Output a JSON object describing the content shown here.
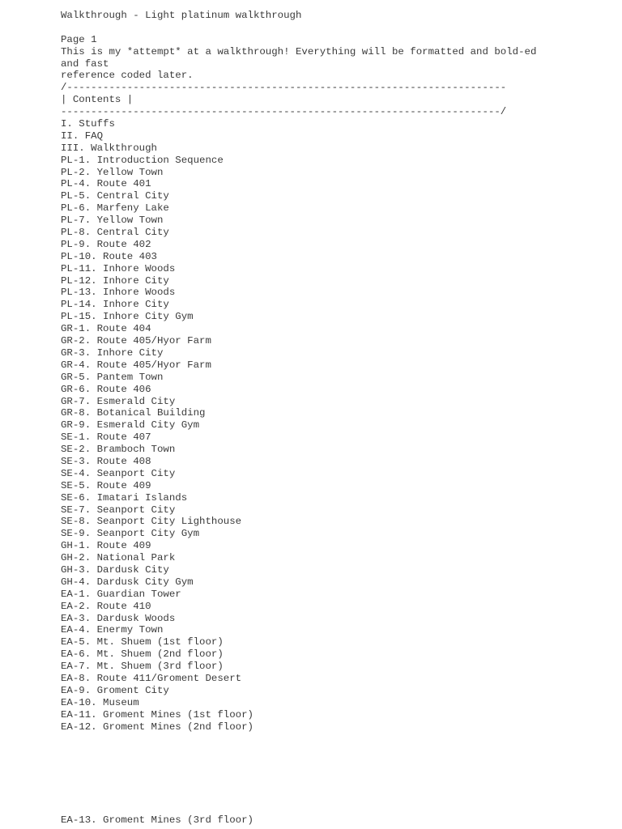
{
  "document": {
    "title": "Walkthrough - Light platinum walkthrough",
    "page_label": "Page 1",
    "intro_lines": [
      "This is my *attempt* at a walkthrough! Everything will be formatted and bold-ed",
      "and fast",
      "reference coded later."
    ],
    "box_top": "/-------------------------------------------------------------------------",
    "box_label": "| Contents |",
    "box_bottom": "-------------------------------------------------------------------------/",
    "contents": [
      "I. Stuffs",
      "II. FAQ",
      "III. Walkthrough",
      "PL-1. Introduction Sequence",
      "PL-2. Yellow Town",
      "PL-4. Route 401",
      "PL-5. Central City",
      "PL-6. Marfeny Lake",
      "PL-7. Yellow Town",
      "PL-8. Central City",
      "PL-9. Route 402",
      "PL-10. Route 403",
      "PL-11. Inhore Woods",
      "PL-12. Inhore City",
      "PL-13. Inhore Woods",
      "PL-14. Inhore City",
      "PL-15. Inhore City Gym",
      "GR-1. Route 404",
      "GR-2. Route 405/Hyor Farm",
      "GR-3. Inhore City",
      "GR-4. Route 405/Hyor Farm",
      "GR-5. Pantem Town",
      "GR-6. Route 406",
      "GR-7. Esmerald City",
      "GR-8. Botanical Building",
      "GR-9. Esmerald City Gym",
      "SE-1. Route 407",
      "SE-2. Bramboch Town",
      "SE-3. Route 408",
      "SE-4. Seanport City",
      "SE-5. Route 409",
      "SE-6. Imatari Islands",
      "SE-7. Seanport City",
      "SE-8. Seanport City Lighthouse",
      "SE-9. Seanport City Gym",
      "GH-1. Route 409",
      "GH-2. National Park",
      "GH-3. Dardusk City",
      "GH-4. Dardusk City Gym",
      "EA-1. Guardian Tower",
      "EA-2. Route 410",
      "EA-3. Dardusk Woods",
      "EA-4. Enermy Town",
      "EA-5. Mt. Shuem (1st floor)",
      "EA-6. Mt. Shuem (2nd floor)",
      "EA-7. Mt. Shuem (3rd floor)",
      "EA-8. Route 411/Groment Desert",
      "EA-9. Groment City",
      "EA-10. Museum",
      "EA-11. Groment Mines (1st floor)",
      "EA-12. Groment Mines (2nd floor)"
    ],
    "next_page_first_line": "EA-13. Groment Mines (3rd floor)"
  }
}
